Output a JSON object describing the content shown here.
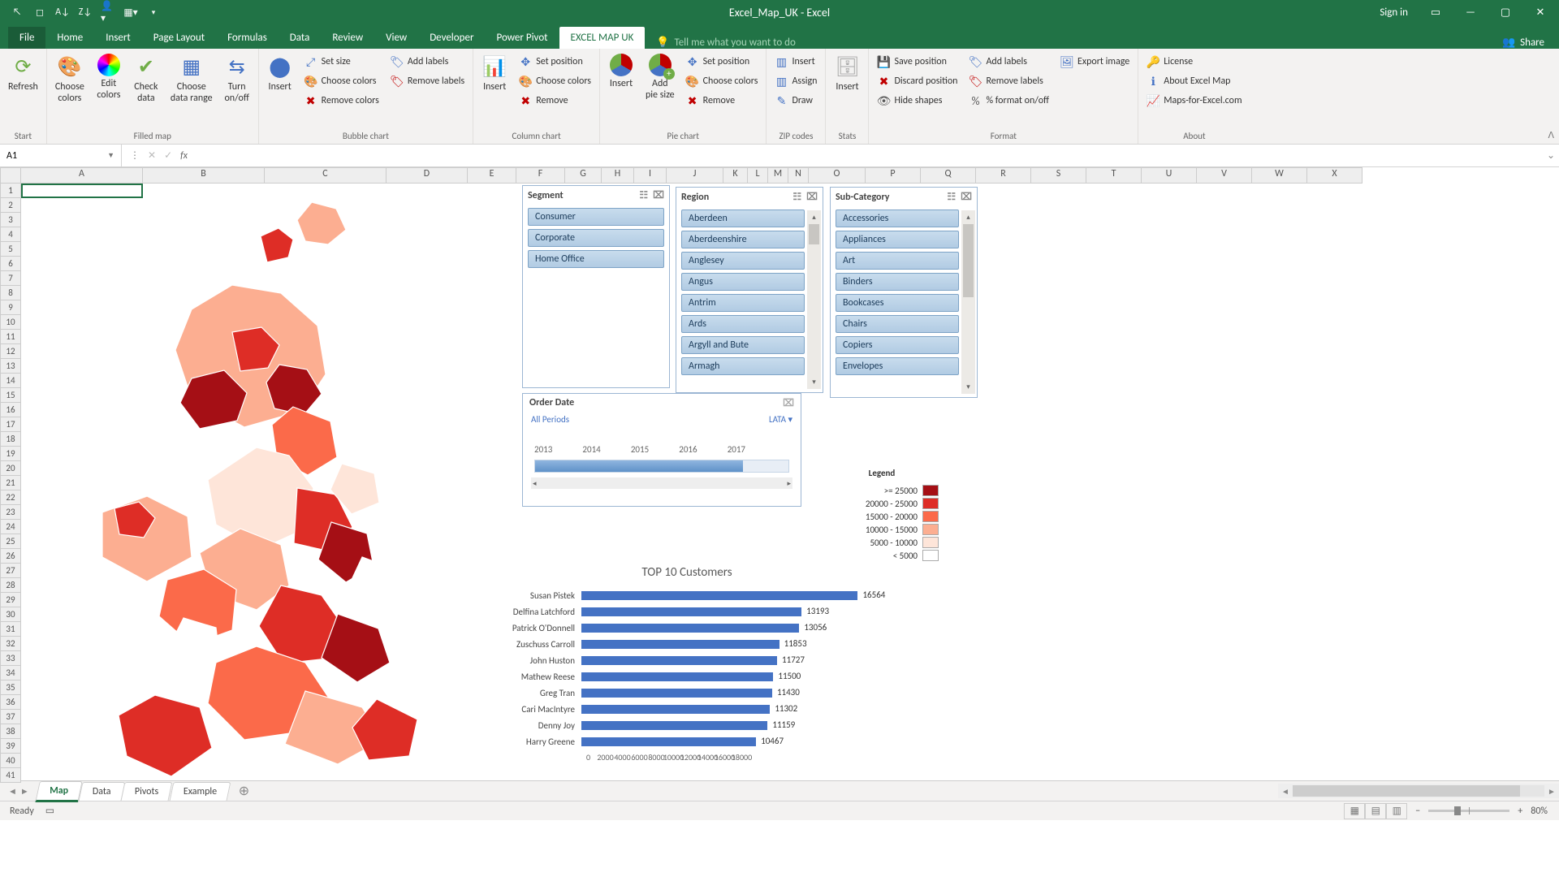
{
  "titlebar": {
    "title": "Excel_Map_UK  -  Excel",
    "signin": "Sign in"
  },
  "tabs": {
    "file": "File",
    "home": "Home",
    "insert": "Insert",
    "pagelayout": "Page Layout",
    "formulas": "Formulas",
    "data": "Data",
    "review": "Review",
    "view": "View",
    "developer": "Developer",
    "powerpivot": "Power Pivot",
    "mapuk": "EXCEL MAP UK",
    "tellme": "Tell me what you want to do",
    "share": "Share"
  },
  "ribbon": {
    "start": {
      "label": "Start",
      "refresh": "Refresh"
    },
    "filledmap": {
      "label": "Filled map",
      "choosecolors": "Choose\ncolors",
      "editcolors": "Edit\ncolors",
      "checkdata": "Check\ndata",
      "choosedatarange": "Choose\ndata range",
      "turnonoff": "Turn\non/off"
    },
    "bubble": {
      "label": "Bubble chart",
      "insert": "Insert",
      "setsize": "Set size",
      "choosecolors": "Choose colors",
      "removecolors": "Remove colors",
      "addlabels": "Add labels",
      "removelabels": "Remove labels"
    },
    "column": {
      "label": "Column chart",
      "insert": "Insert",
      "setposition": "Set position",
      "choosecolors": "Choose colors",
      "remove": "Remove"
    },
    "pie": {
      "label": "Pie chart",
      "insert": "Insert",
      "addpiesize": "Add\npie size",
      "setposition": "Set position",
      "choosecolors": "Choose colors",
      "remove": "Remove"
    },
    "zip": {
      "label": "ZIP codes",
      "insert": "Insert",
      "assign": "Assign",
      "draw": "Draw"
    },
    "stats": {
      "label": "Stats",
      "insert": "Insert"
    },
    "format": {
      "label": "Format",
      "saveposition": "Save position",
      "discardposition": "Discard position",
      "hideshapes": "Hide shapes",
      "addlabels": "Add labels",
      "removelabels": "Remove labels",
      "pctformat": "% format on/off",
      "exportimage": "Export image"
    },
    "about": {
      "label": "About",
      "license": "License",
      "aboutmap": "About Excel Map",
      "mapsfor": "Maps-for-Excel.com"
    }
  },
  "formula_bar": {
    "ref": "A1"
  },
  "columns": [
    "A",
    "B",
    "C",
    "D",
    "E",
    "F",
    "G",
    "H",
    "I",
    "J",
    "K",
    "L",
    "M",
    "N",
    "O",
    "P",
    "Q",
    "R",
    "S",
    "T",
    "U",
    "V",
    "W",
    "X"
  ],
  "rowcount": 41,
  "slicers": {
    "segment": {
      "title": "Segment",
      "items": [
        "Consumer",
        "Corporate",
        "Home Office"
      ]
    },
    "region": {
      "title": "Region",
      "items": [
        "Aberdeen",
        "Aberdeenshire",
        "Anglesey",
        "Angus",
        "Antrim",
        "Ards",
        "Argyll and Bute",
        "Armagh"
      ]
    },
    "subcat": {
      "title": "Sub-Category",
      "items": [
        "Accessories",
        "Appliances",
        "Art",
        "Binders",
        "Bookcases",
        "Chairs",
        "Copiers",
        "Envelopes"
      ]
    }
  },
  "timeline": {
    "title": "Order Date",
    "period": "All Periods",
    "unit": "LATA",
    "years": [
      "2013",
      "2014",
      "2015",
      "2016",
      "2017"
    ]
  },
  "legend": {
    "title": "Legend",
    "rows": [
      {
        "text": ">=   25000",
        "color": "#a50f15"
      },
      {
        "text": "20000  -  25000",
        "color": "#de2d26"
      },
      {
        "text": "15000  -  20000",
        "color": "#fb6a4a"
      },
      {
        "text": "10000  -  15000",
        "color": "#fcae91"
      },
      {
        "text": "5000  -  10000",
        "color": "#fee5d9"
      },
      {
        "text": "<    5000",
        "color": "#ffffff"
      }
    ]
  },
  "chart_data": {
    "type": "bar",
    "title": "TOP 10 Customers",
    "orientation": "horizontal",
    "xlabel": "",
    "ylabel": "",
    "xlim": [
      0,
      18000
    ],
    "xticks": [
      0,
      2000,
      4000,
      6000,
      8000,
      10000,
      12000,
      14000,
      16000,
      18000
    ],
    "categories": [
      "Susan Pistek",
      "Delfina Latchford",
      "Patrick O'Donnell",
      "Zuschuss Carroll",
      "John Huston",
      "Mathew Reese",
      "Greg Tran",
      "Cari MacIntyre",
      "Denny Joy",
      "Harry Greene"
    ],
    "values": [
      16564,
      13193,
      13056,
      11853,
      11727,
      11500,
      11430,
      11302,
      11159,
      10467
    ]
  },
  "sheets": {
    "map": "Map",
    "data": "Data",
    "pivots": "Pivots",
    "example": "Example"
  },
  "status": {
    "ready": "Ready",
    "zoom": "80%"
  }
}
